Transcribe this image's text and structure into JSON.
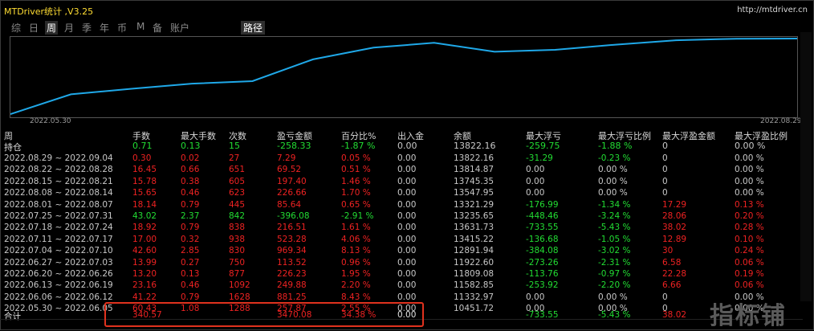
{
  "app": {
    "title": "MTDriver统计 ,V3.25",
    "url": "http://mtdriver.cn"
  },
  "tabs": [
    "综",
    "日",
    "周",
    "月",
    "季",
    "年",
    "币",
    "M",
    "备",
    "账户"
  ],
  "active_tab": "周",
  "route_tab": "路径",
  "chart": {
    "start_date": "2022.05.30",
    "end_date": "2022.08.29",
    "line_color": "#1fa8e8"
  },
  "chart_data": {
    "type": "line",
    "x": [
      "2022.05.30",
      "2022.06.06",
      "2022.06.13",
      "2022.06.20",
      "2022.06.27",
      "2022.07.04",
      "2022.07.11",
      "2022.07.18",
      "2022.07.25",
      "2022.08.01",
      "2022.08.08",
      "2022.08.15",
      "2022.08.22",
      "2022.08.29"
    ],
    "values": [
      10451.72,
      11332.97,
      11582.85,
      11809.08,
      11922.6,
      12891.94,
      13415.22,
      13631.73,
      13235.65,
      13321.29,
      13547.95,
      13745.35,
      13814.87,
      13822.16
    ]
  },
  "table": {
    "headers": [
      "周",
      "手数",
      "最大手数",
      "次数",
      "盈亏金额",
      "百分比%",
      "出入金",
      "余额",
      "最大浮亏",
      "最大浮亏比例",
      "最大浮盈金额",
      "最大浮盈比例"
    ],
    "holding": {
      "label": "持仓",
      "cells": [
        "0.71",
        "0.13",
        "15",
        "-258.33",
        "-1.87 %",
        "0.00",
        "13822.16",
        "-259.75",
        "-1.88 %",
        "0",
        "0.00 %"
      ]
    },
    "rows": [
      {
        "period": "2022.08.29 ~ 2022.09.04",
        "cells": [
          "0.30",
          "0.02",
          "27",
          "7.29",
          "0.05 %",
          "0.00",
          "13822.16",
          "-31.29",
          "-0.23 %",
          "0",
          "0.00 %"
        ]
      },
      {
        "period": "2022.08.22 ~ 2022.08.28",
        "cells": [
          "16.45",
          "0.66",
          "651",
          "69.52",
          "0.51 %",
          "0.00",
          "13814.87",
          "0.00",
          "0.00 %",
          "0",
          "0.00 %"
        ]
      },
      {
        "period": "2022.08.15 ~ 2022.08.21",
        "cells": [
          "15.78",
          "0.38",
          "605",
          "197.40",
          "1.46 %",
          "0.00",
          "13745.35",
          "0.00",
          "0.00 %",
          "0",
          "0.00 %"
        ]
      },
      {
        "period": "2022.08.08 ~ 2022.08.14",
        "cells": [
          "15.65",
          "0.46",
          "623",
          "226.66",
          "1.70 %",
          "0.00",
          "13547.95",
          "0.00",
          "0.00 %",
          "0",
          "0.00 %"
        ]
      },
      {
        "period": "2022.08.01 ~ 2022.08.07",
        "cells": [
          "18.14",
          "0.79",
          "445",
          "85.64",
          "0.65 %",
          "0.00",
          "13321.29",
          "-176.99",
          "-1.34 %",
          "17.29",
          "0.13 %"
        ]
      },
      {
        "period": "2022.07.25 ~ 2022.07.31",
        "cells": [
          "43.02",
          "2.37",
          "842",
          "-396.08",
          "-2.91 %",
          "0.00",
          "13235.65",
          "-448.46",
          "-3.24 %",
          "28.06",
          "0.20 %"
        ]
      },
      {
        "period": "2022.07.18 ~ 2022.07.24",
        "cells": [
          "18.92",
          "0.79",
          "838",
          "216.51",
          "1.61 %",
          "0.00",
          "13631.73",
          "-733.55",
          "-5.43 %",
          "38.02",
          "0.28 %"
        ]
      },
      {
        "period": "2022.07.11 ~ 2022.07.17",
        "cells": [
          "17.00",
          "0.32",
          "938",
          "523.28",
          "4.06 %",
          "0.00",
          "13415.22",
          "-136.68",
          "-1.05 %",
          "12.89",
          "0.10 %"
        ]
      },
      {
        "period": "2022.07.04 ~ 2022.07.10",
        "cells": [
          "42.60",
          "2.85",
          "830",
          "969.34",
          "8.13 %",
          "0.00",
          "12891.94",
          "-384.08",
          "-3.02 %",
          "30",
          "0.24 %"
        ]
      },
      {
        "period": "2022.06.27 ~ 2022.07.03",
        "cells": [
          "13.99",
          "0.27",
          "750",
          "113.52",
          "0.96 %",
          "0.00",
          "11922.60",
          "-273.26",
          "-2.31 %",
          "6.58",
          "0.06 %"
        ]
      },
      {
        "period": "2022.06.20 ~ 2022.06.26",
        "cells": [
          "13.20",
          "0.13",
          "877",
          "226.23",
          "1.95 %",
          "0.00",
          "11809.08",
          "-113.76",
          "-0.97 %",
          "22.28",
          "0.19 %"
        ]
      },
      {
        "period": "2022.06.13 ~ 2022.06.19",
        "cells": [
          "23.16",
          "0.46",
          "1092",
          "249.88",
          "2.20 %",
          "0.00",
          "11582.85",
          "-253.92",
          "-2.20 %",
          "6.66",
          "0.06 %"
        ]
      },
      {
        "period": "2022.06.06 ~ 2022.06.12",
        "cells": [
          "41.22",
          "0.79",
          "1628",
          "881.25",
          "8.43 %",
          "0.00",
          "11332.97",
          "0.00",
          "0.00 %",
          "0",
          "0.00 %"
        ]
      },
      {
        "period": "2022.05.30 ~ 2022.06.05",
        "cells": [
          "60.43",
          "1.08",
          "1288",
          "257.87",
          "2.55 %",
          "0.00",
          "10451.72",
          "0.00",
          "0.00 %",
          "0",
          "0.00 %"
        ]
      }
    ],
    "total": {
      "label": "合计",
      "cells": [
        "340.57",
        "",
        "",
        "3470.08",
        "34.38 %",
        "0.00",
        "",
        "-733.55",
        "-5.43 %",
        "38.02",
        ""
      ]
    }
  },
  "watermark": "指标铺",
  "colors": {
    "positive": "#ee2222",
    "negative": "#22dd33",
    "neutral": "#e0e0e0",
    "highlight_box": "#e0321e"
  }
}
